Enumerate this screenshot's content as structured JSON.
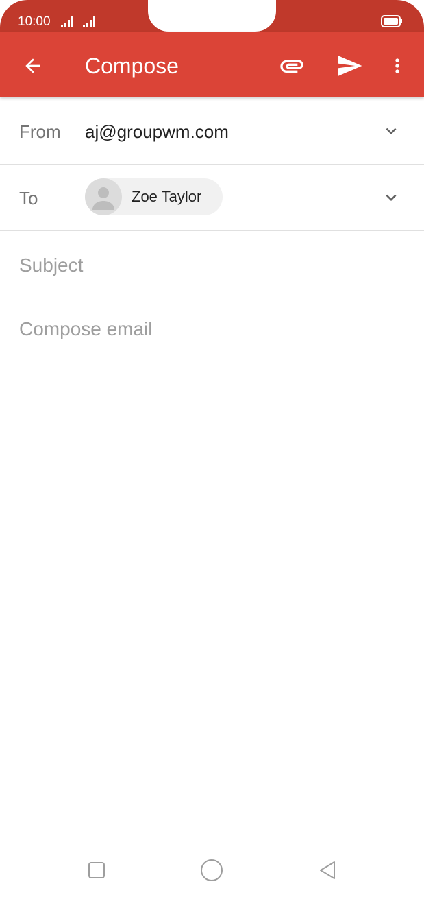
{
  "status_bar": {
    "time": "10:00",
    "icons": [
      "signal-icon",
      "signal-icon",
      "battery-icon"
    ],
    "background_color": "#c0392b"
  },
  "app_bar": {
    "title": "Compose",
    "background_color": "#db4437",
    "icons": {
      "back": "arrow-back-icon",
      "attach": "paperclip-icon",
      "send": "send-icon",
      "more": "more-vert-icon"
    }
  },
  "from": {
    "label": "From",
    "value": "aj@groupwm.com"
  },
  "to": {
    "label": "To",
    "recipients": [
      {
        "name": "Zoe Taylor"
      }
    ]
  },
  "subject": {
    "value": "",
    "placeholder": "Subject"
  },
  "body": {
    "value": "",
    "placeholder": "Compose email"
  },
  "nav_bar": {
    "icons": [
      "recent-apps-icon",
      "home-icon",
      "back-icon"
    ]
  }
}
